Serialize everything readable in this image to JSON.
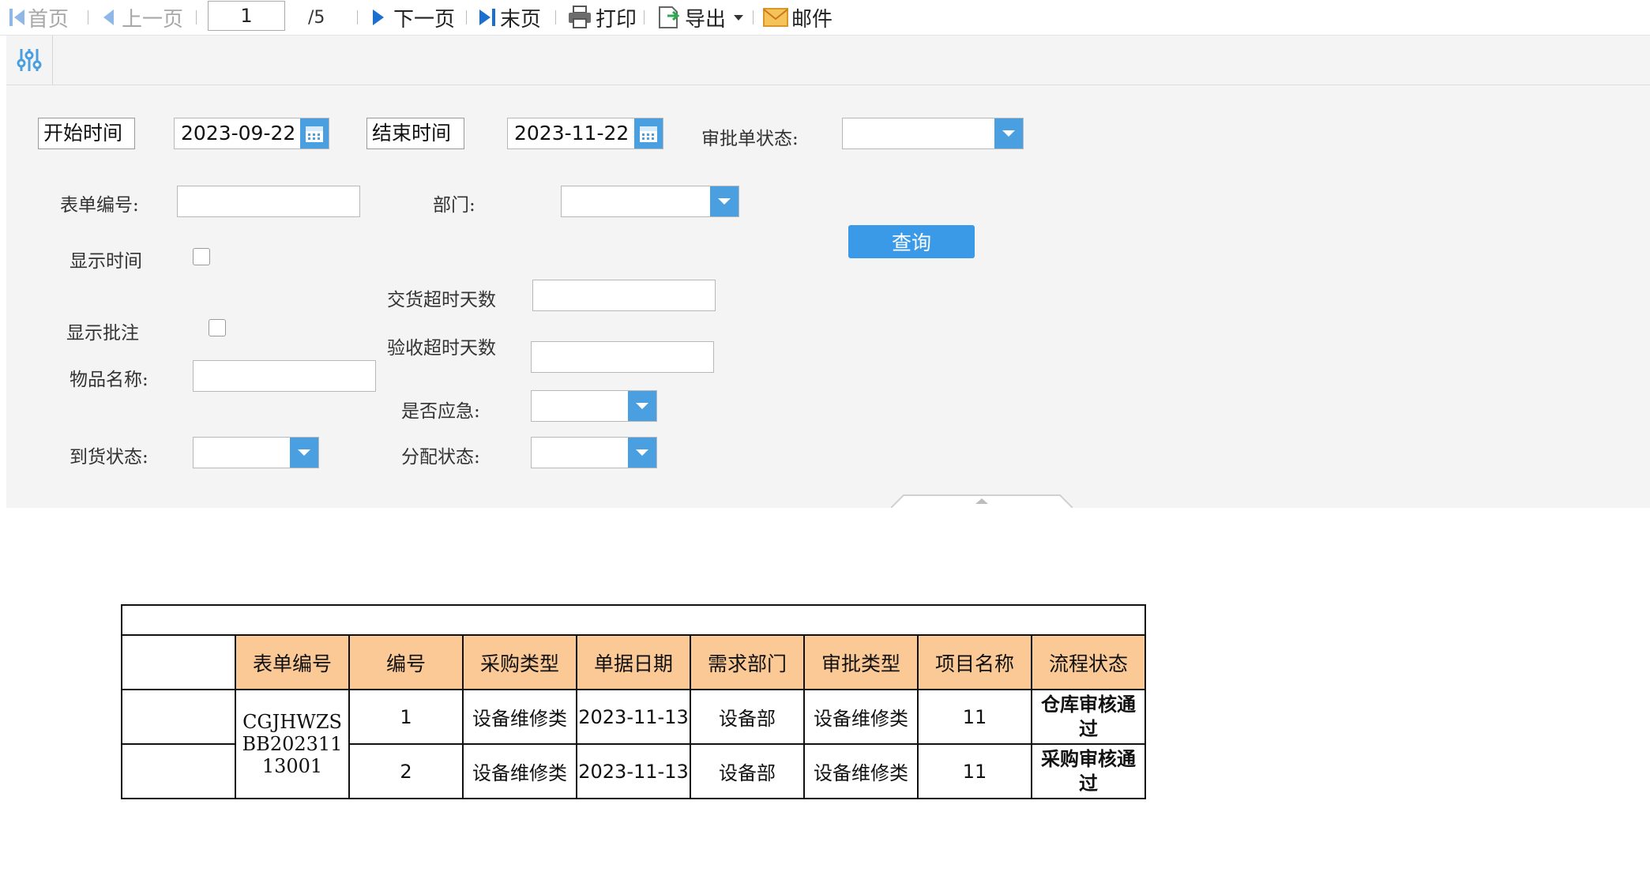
{
  "toolbar": {
    "first": "首页",
    "prev": "上一页",
    "page_value": "1",
    "page_total": "/5",
    "next": "下一页",
    "last": "末页",
    "print": "打印",
    "export": "导出",
    "mail": "邮件"
  },
  "filters": {
    "start_time_label": "开始时间",
    "start_date": "2023-09-22",
    "end_time_label": "结束时间",
    "end_date": "2023-11-22",
    "approval_status_label": "审批单状态:",
    "approval_status_value": "",
    "form_no_label": "表单编号:",
    "form_no_value": "",
    "department_label": "部门:",
    "department_value": "",
    "query_button": "查询",
    "show_time_label": "显示时间",
    "show_time_checked": false,
    "delivery_overdue_label": "交货超时天数",
    "delivery_overdue_value": "",
    "show_notes_label": "显示批注",
    "show_notes_checked": false,
    "acceptance_overdue_label": "验收超时天数",
    "acceptance_overdue_value": "",
    "item_name_label": "物品名称:",
    "item_name_value": "",
    "urgent_label": "是否应急:",
    "urgent_value": "",
    "arrival_status_label": "到货状态:",
    "arrival_status_value": "",
    "allocation_status_label": "分配状态:",
    "allocation_status_value": ""
  },
  "table": {
    "headers": [
      "表单编号",
      "编号",
      "采购类型",
      "单据日期",
      "需求部门",
      "审批类型",
      "项目名称",
      "流程状态"
    ],
    "form_no": "CGJHWZSBB20231113001",
    "rows": [
      {
        "no": "1",
        "type": "设备维修类",
        "date": "2023-11-13",
        "dept": "设备部",
        "approval_type": "设备维修类",
        "project": "11",
        "status": "仓库审核通过"
      },
      {
        "no": "2",
        "type": "设备维修类",
        "date": "2023-11-13",
        "dept": "设备部",
        "approval_type": "设备维修类",
        "project": "11",
        "status": "采购审核通过"
      }
    ],
    "status_color": "#e8352f",
    "header_color": "#fbc996"
  }
}
